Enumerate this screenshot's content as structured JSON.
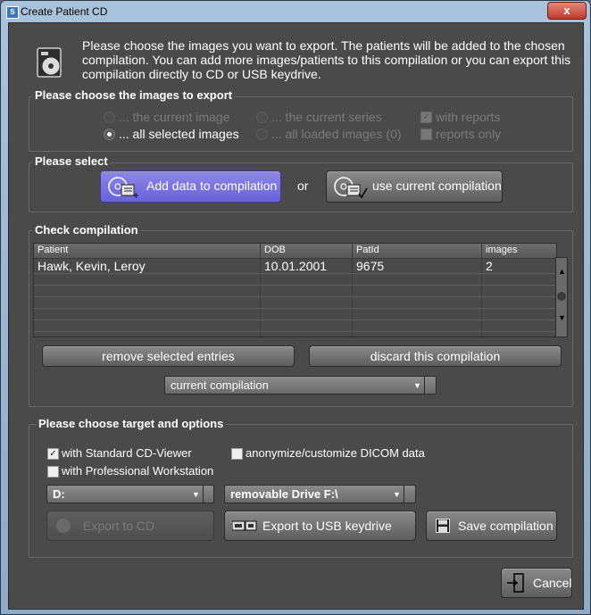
{
  "window": {
    "title": "Create Patient CD",
    "close_label": "x"
  },
  "intro": {
    "text": "Please choose the images you want to export. The patients will be added to the chosen compilation. You can add more images/patients to this compilation or you can export this compilation directly to CD or USB keydrive."
  },
  "images_group": {
    "label": "Please choose the images to export",
    "current_image": "... the current image",
    "current_series": "... the current series",
    "with_reports": "with reports",
    "all_selected": "... all selected images",
    "all_loaded": "... all loaded images (0)",
    "reports_only": "reports only"
  },
  "select_group": {
    "label": "Please select",
    "add_button": "Add data to compilation",
    "or_text": "or",
    "use_button": "use current compilation"
  },
  "compilation_group": {
    "label": "Check compilation",
    "columns": [
      "Patient",
      "DOB",
      "PatId",
      "images"
    ],
    "rows": [
      {
        "patient": "Hawk, Kevin, Leroy",
        "dob": "10.01.2001",
        "patid": "9675",
        "images": "2"
      }
    ],
    "remove_button": "remove selected entries",
    "discard_button": "discard this compilation",
    "compilation_select": "current compilation"
  },
  "target_group": {
    "label": "Please choose target and options",
    "standard_viewer": "with Standard CD-Viewer",
    "standard_viewer_checked": true,
    "anonymize": "anonymize/customize DICOM data",
    "anonymize_checked": false,
    "pro_workstation": "with Professional Workstation",
    "pro_workstation_checked": false,
    "cd_drive": "D:",
    "usb_drive": "removable Drive F:\\",
    "export_cd": "Export to CD",
    "export_usb": "Export to USB keydrive",
    "save_compilation": "Save compilation"
  },
  "footer": {
    "cancel": "Cancel"
  },
  "colors": {
    "accent": "#6a62d8",
    "background": "#4a4a4a",
    "close": "#c0392b"
  }
}
